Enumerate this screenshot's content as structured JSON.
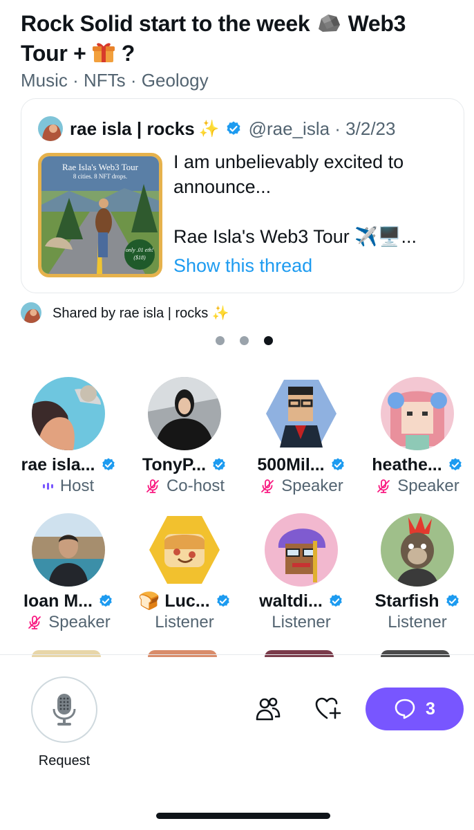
{
  "space": {
    "title_part1": "Rock Solid start to the week",
    "title_part2": "Web3 Tour +",
    "title_part3": "?",
    "topics": "Music · NFTs · Geology"
  },
  "pinned_tweet": {
    "author": "rae isla | rocks",
    "author_sparkle": "✨",
    "handle_date": "@rae_isla · 3/2/23",
    "thumbnail": {
      "title": "Rae Isla's Web3 Tour",
      "subtitle": "8 cities. 8 NFT drops.",
      "price_line1": "only .01 eth!",
      "price_line2": "($18)"
    },
    "text_line1": "I am unbelievably excited to announce...",
    "text_line2": "Rae Isla's Web3 Tour ✈️🖥️...",
    "show_thread": "Show this thread"
  },
  "shared_by": "Shared by rae isla | rocks ✨",
  "pagination": {
    "total": 3,
    "active": 3
  },
  "participants": [
    {
      "name": "rae isla...",
      "role": "Host",
      "verified": true,
      "avatar": "rae-isla-avatar"
    },
    {
      "name": "TonyP...",
      "role": "Co-host",
      "verified": true,
      "avatar": "tonyp-avatar"
    },
    {
      "name": "500Mil...",
      "role": "Speaker",
      "verified": true,
      "avatar": "500mil-avatar"
    },
    {
      "name": "heathe...",
      "role": "Speaker",
      "verified": true,
      "avatar": "heathe-avatar"
    },
    {
      "name": "Ioan M...",
      "role": "Speaker",
      "verified": true,
      "avatar": "ioan-avatar"
    },
    {
      "name": "🍞 Luc...",
      "role": "Listener",
      "verified": true,
      "avatar": "luc-avatar"
    },
    {
      "name": "waltdi...",
      "role": "Listener",
      "verified": true,
      "avatar": "waltdi-avatar"
    },
    {
      "name": "Starfish",
      "role": "Listener",
      "verified": true,
      "avatar": "starfish-avatar"
    }
  ],
  "bottom_bar": {
    "request_label": "Request",
    "chat_count": "3"
  },
  "colors": {
    "accent_purple": "#7856ff",
    "verified_blue": "#1d9bf0",
    "muted_pink": "#f91880",
    "secondary_text": "#536471"
  }
}
